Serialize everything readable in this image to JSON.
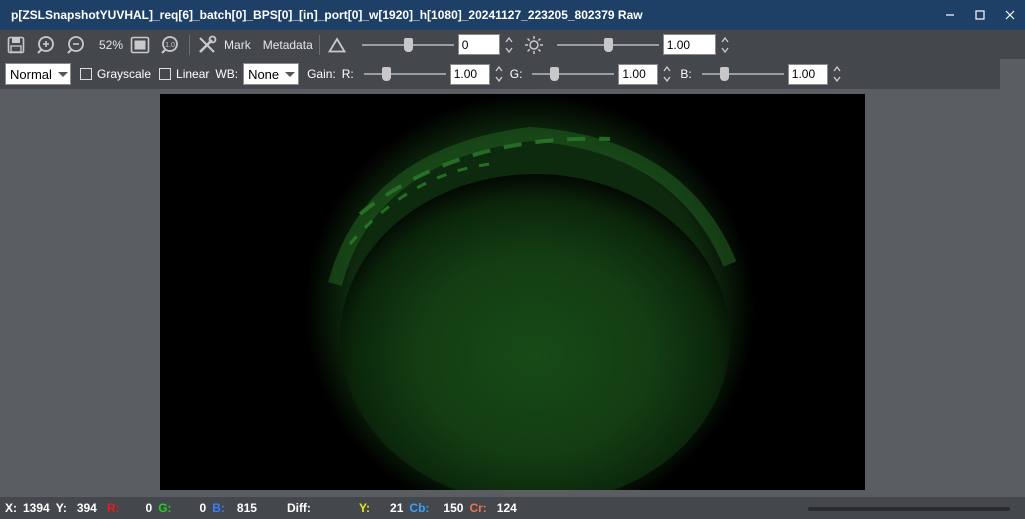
{
  "window": {
    "title": "p[ZSLSnapshotYUVHAL]_req[6]_batch[0]_BPS[0]_[in]_port[0]_w[1920]_h[1080]_20241127_223205_802379 Raw",
    "buttons": [
      "minimize-icon",
      "maximize-icon",
      "close-icon"
    ]
  },
  "toolbar1": {
    "icons": [
      "save-icon",
      "zoom-in-icon",
      "zoom-out-icon"
    ],
    "zoom": "52%",
    "fit_icon": "fit-window-icon",
    "actual_size_icon": "actual-size-icon",
    "mark_icon": "tools-icon",
    "mark_label": "Mark",
    "metadata_label": "Metadata",
    "contrast_icon": "triangle-icon",
    "contrast_value": "0",
    "contrast_level": 0.5,
    "brightness_icon": "sun-icon",
    "brightness_value": "1.00",
    "brightness_level": 0.5
  },
  "toolbar2": {
    "mode_select": "Normal",
    "grayscale_label": "Grayscale",
    "grayscale_checked": false,
    "linear_label": "Linear",
    "linear_checked": false,
    "wb_label": "WB:",
    "wb_select": "None",
    "gain_label": "Gain:",
    "r_label": "R:",
    "r_value": "1.00",
    "r_level": 0.25,
    "g_label": "G:",
    "g_value": "1.00",
    "g_level": 0.25,
    "b_label": "B:",
    "b_value": "1.00",
    "b_level": 0.25
  },
  "status": {
    "x_label": "X:",
    "x_value": "1394",
    "y_label": "Y:",
    "y_value": "394",
    "r_label": "R:",
    "r_value": "0",
    "g_label": "G:",
    "g_value": "0",
    "b_label": "B:",
    "b_value": "815",
    "diff_label": "Diff:",
    "yy_label": "Y:",
    "yy_value": "21",
    "cb_label": "Cb:",
    "cb_value": "150",
    "cr_label": "Cr:",
    "cr_value": "124",
    "colors": {
      "r": "#e02020",
      "g": "#20d020",
      "b": "#3b7bff",
      "y": "#f0e020",
      "cb": "#3aa0ff",
      "cr": "#f07050"
    }
  },
  "colors": {
    "titlebar": "#1e3f66",
    "toolbar": "#44484d",
    "background": "#5a5e63",
    "image_tint": "#1f5a1f"
  }
}
